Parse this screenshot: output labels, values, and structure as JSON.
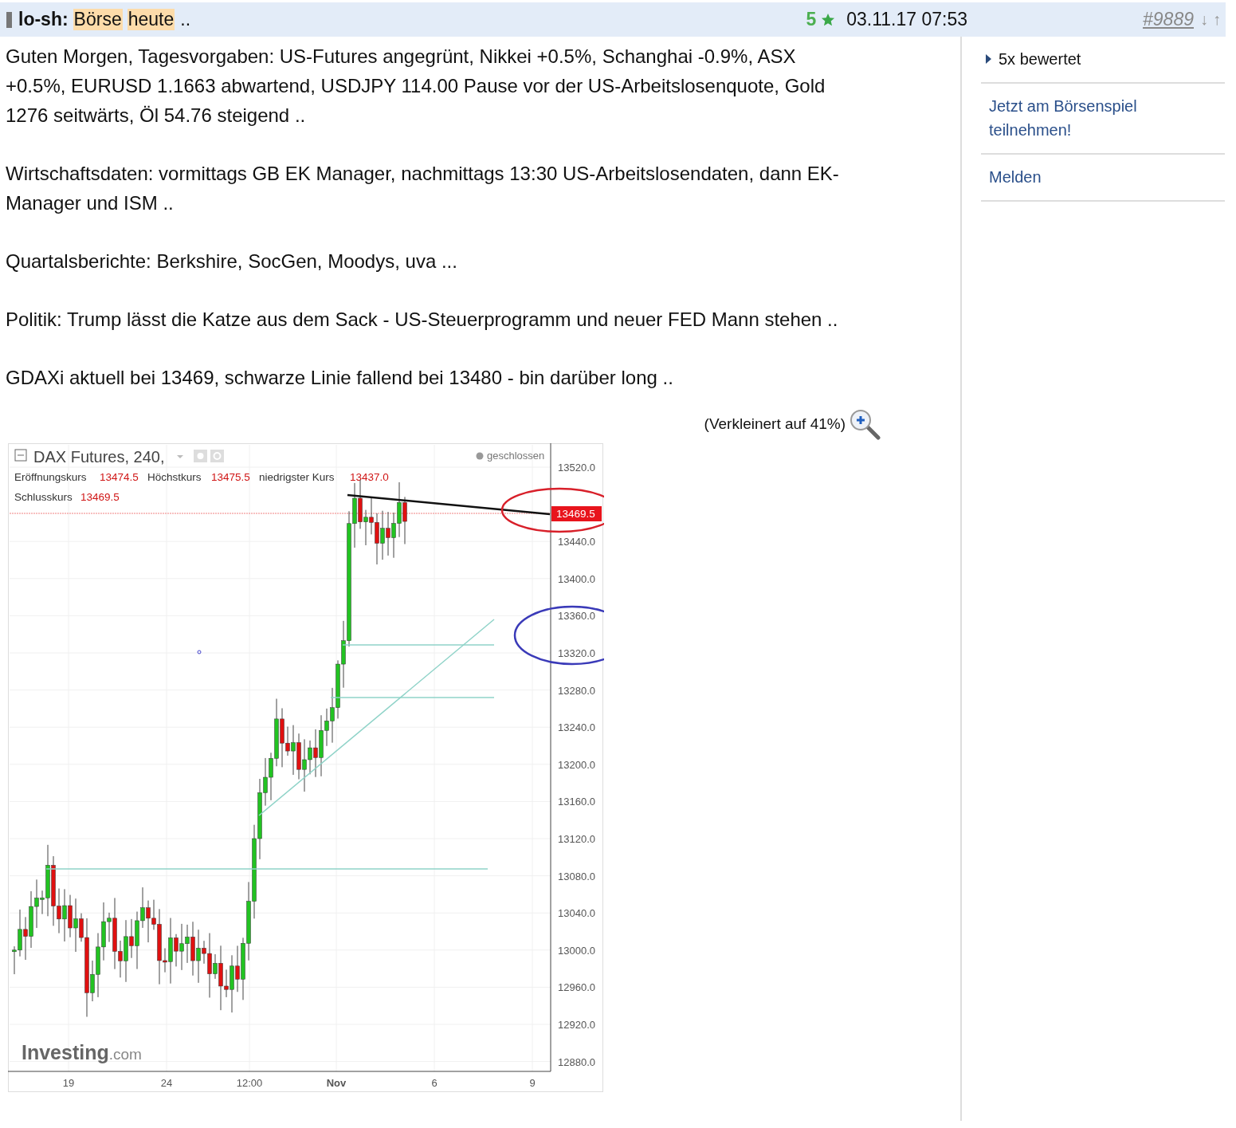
{
  "header": {
    "author": "lo-sh:",
    "title_parts": [
      {
        "text": "Börse",
        "highlighted": true
      },
      {
        "text": "heute",
        "highlighted": true
      },
      {
        "text": "..",
        "highlighted": false
      }
    ],
    "rating": "5",
    "timestamp": "03.11.17 07:53",
    "post_number": "#9889",
    "nav": [
      "↓",
      "↑"
    ]
  },
  "post": {
    "paragraphs": [
      "Guten Morgen, Tagesvorgaben: US-Futures angegrünt, Nikkei +0.5%, Schanghai -0.9%, ASX +0.5%, EURUSD 1.1663 abwartend, USDJPY 114.00 Pause vor der US-Arbeitslosenquote, Gold 1276 seitwärts, Öl 54.76 steigend ..",
      "Wirtschaftsdaten: vormittags GB EK Manager, nachmittags 13:30 US-Arbeitslosendaten, dann EK-Manager und ISM ..",
      "Quartalsberichte: Berkshire, SocGen, Moodys, uva ...",
      "Politik: Trump lässt die Katze aus dem Sack - US-Steuerprogramm und neuer FED Mann stehen ..",
      "GDAXi aktuell bei 13469, schwarze Linie fallend bei 13480 - bin darüber long .."
    ],
    "image_note": "(Verkleinert auf 41%)",
    "chart": {
      "title": "DAX Futures, 240,",
      "status": "geschlossen",
      "quotes": [
        {
          "label": "Eröffnungskurs",
          "value": "13474.5"
        },
        {
          "label": "Höchstkurs",
          "value": "13475.5"
        },
        {
          "label": "niedrigster Kurs",
          "value": "13437.0"
        },
        {
          "label": "Schlusskurs",
          "value": "13469.5"
        }
      ],
      "current_price": "13469.5",
      "y_labels": [
        "13520.0",
        "13440.0",
        "13400.0",
        "13360.0",
        "13320.0",
        "13280.0",
        "13240.0",
        "13200.0",
        "13160.0",
        "13120.0",
        "13080.0",
        "13040.0",
        "13000.0",
        "12960.0",
        "12920.0",
        "12880.0"
      ],
      "x_labels": [
        {
          "text": "19",
          "bold": false
        },
        {
          "text": "24",
          "bold": false
        },
        {
          "text": "12:00",
          "bold": false
        },
        {
          "text": "Nov",
          "bold": true
        },
        {
          "text": "6",
          "bold": false
        },
        {
          "text": "9",
          "bold": false
        }
      ],
      "logo": {
        "name": "Investing",
        "suffix": ".com"
      }
    }
  },
  "sidebar": {
    "ratings": {
      "label": "5x bewertet",
      "expanded": false
    },
    "links": [
      "Jetzt am Börsenspiel teilnehmen!",
      "Melden"
    ]
  }
}
